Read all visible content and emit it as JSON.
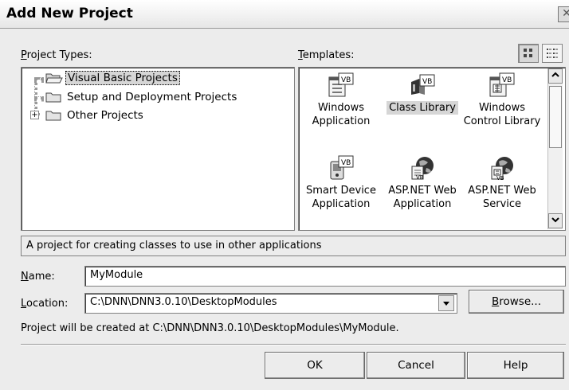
{
  "dialog": {
    "title": "Add New Project",
    "close_glyph": "✕"
  },
  "project_types": {
    "label": "Project Types:",
    "label_mnemonic": "P",
    "label_rest": "roject Types:",
    "items": [
      {
        "label": "Visual Basic Projects",
        "selected": true,
        "icon": "folder-open-icon",
        "expander": ""
      },
      {
        "label": "Setup and Deployment Projects",
        "selected": false,
        "icon": "folder-icon",
        "expander": ""
      },
      {
        "label": "Other Projects",
        "selected": false,
        "icon": "folder-icon",
        "expander": "+"
      }
    ]
  },
  "templates": {
    "label_mnemonic": "T",
    "label_rest": "emplates:",
    "items": [
      {
        "line1": "Windows",
        "line2": "Application",
        "icon": "windows-application-icon",
        "selected": false
      },
      {
        "line1": "Class Library",
        "line2": "",
        "icon": "class-library-icon",
        "selected": true
      },
      {
        "line1": "Windows",
        "line2": "Control Library",
        "icon": "windows-control-library-icon",
        "selected": false
      },
      {
        "line1": "Smart Device",
        "line2": "Application",
        "icon": "smart-device-icon",
        "selected": false
      },
      {
        "line1": "ASP.NET Web",
        "line2": "Application",
        "icon": "aspnet-web-application-icon",
        "selected": false
      },
      {
        "line1": "ASP.NET Web",
        "line2": "Service",
        "icon": "aspnet-web-service-icon",
        "selected": false
      }
    ],
    "view_large": "large-icons-view-icon",
    "view_small": "small-icons-view-icon"
  },
  "description": "A project for creating classes to use in other applications",
  "name_field": {
    "label_mnemonic": "N",
    "label_rest": "ame:",
    "value": "MyModule"
  },
  "location_field": {
    "label_mnemonic": "L",
    "label_rest": "ocation:",
    "value": "C:\\DNN\\DNN3.0.10\\DesktopModules"
  },
  "browse_button": {
    "mnemonic": "B",
    "rest": "rowse..."
  },
  "created_at_text": "Project will be created at C:\\DNN\\DNN3.0.10\\DesktopModules\\MyModule.",
  "buttons": {
    "ok": "OK",
    "cancel": "Cancel",
    "help": "Help"
  }
}
